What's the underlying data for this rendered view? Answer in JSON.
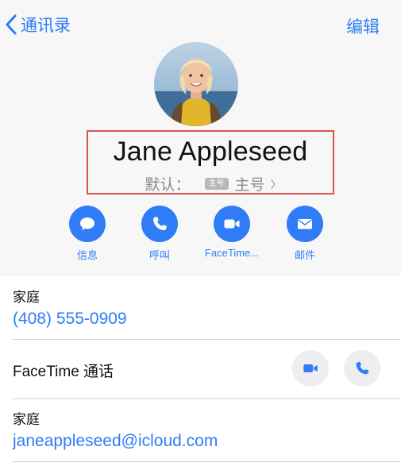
{
  "nav": {
    "back_label": "通讯录",
    "edit_label": "编辑"
  },
  "contact": {
    "name": "Jane Appleseed",
    "default_label": "默认：",
    "sim_badge": "主号",
    "sim_name": "主号"
  },
  "actions": [
    {
      "label": "信息",
      "icon": "message-icon"
    },
    {
      "label": "呼叫",
      "icon": "phone-icon"
    },
    {
      "label": "FaceTime...",
      "icon": "video-icon"
    },
    {
      "label": "邮件",
      "icon": "mail-icon"
    }
  ],
  "fields": {
    "phone": {
      "label": "家庭",
      "value": "(408) 555-0909"
    },
    "facetime": {
      "label": "FaceTime 通话"
    },
    "email": {
      "label": "家庭",
      "value": "janeappleseed@icloud.com"
    }
  },
  "colors": {
    "accent": "#2f7cf6",
    "highlight_box": "#d9534f"
  }
}
